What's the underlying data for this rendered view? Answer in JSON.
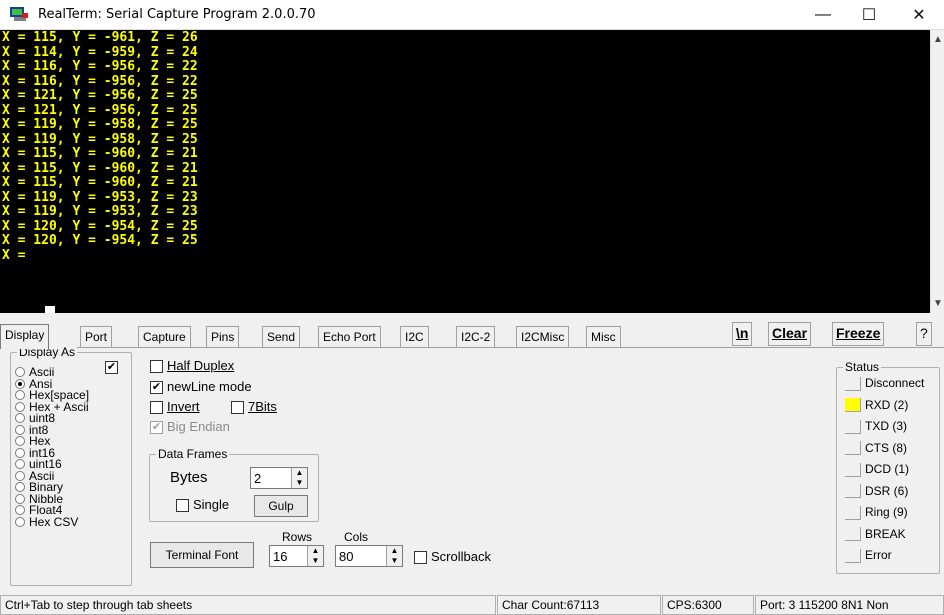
{
  "window": {
    "title": "RealTerm: Serial Capture Program 2.0.0.70",
    "minimize": "—",
    "maximize": "☐",
    "close": "✕"
  },
  "terminal": {
    "lines": [
      "X = 115, Y = -961, Z = 26",
      "X = 114, Y = -959, Z = 24",
      "X = 116, Y = -956, Z = 22",
      "X = 116, Y = -956, Z = 22",
      "X = 121, Y = -956, Z = 25",
      "X = 121, Y = -956, Z = 25",
      "X = 119, Y = -958, Z = 25",
      "X = 119, Y = -958, Z = 25",
      "X = 115, Y = -960, Z = 21",
      "X = 115, Y = -960, Z = 21",
      "X = 115, Y = -960, Z = 21",
      "X = 119, Y = -953, Z = 23",
      "X = 119, Y = -953, Z = 23",
      "X = 120, Y = -954, Z = 25",
      "X = 120, Y = -954, Z = 25",
      "X = "
    ],
    "text_color": "#ffff00",
    "background": "#000000"
  },
  "tabs": [
    {
      "label": "Display",
      "active": true
    },
    {
      "label": "Port"
    },
    {
      "label": "Capture"
    },
    {
      "label": "Pins"
    },
    {
      "label": "Send"
    },
    {
      "label": "Echo Port"
    },
    {
      "label": "I2C"
    },
    {
      "label": "I2C-2"
    },
    {
      "label": "I2CMisc"
    },
    {
      "label": "Misc"
    }
  ],
  "toolbar": {
    "newline_label": "\\n",
    "clear_label": "Clear",
    "freeze_label": "Freeze",
    "help_label": "?"
  },
  "display_as": {
    "legend": "Display As",
    "options": [
      {
        "label": "Ascii",
        "selected": false
      },
      {
        "label": "Ansi",
        "selected": true
      },
      {
        "label": "Hex[space]",
        "selected": false
      },
      {
        "label": "Hex + Ascii",
        "selected": false
      },
      {
        "label": "uint8",
        "selected": false
      },
      {
        "label": "int8",
        "selected": false
      },
      {
        "label": "Hex",
        "selected": false
      },
      {
        "label": "int16",
        "selected": false
      },
      {
        "label": "uint16",
        "selected": false
      },
      {
        "label": "Ascii",
        "selected": false
      },
      {
        "label": "Binary",
        "selected": false
      },
      {
        "label": "Nibble",
        "selected": false
      },
      {
        "label": "Float4",
        "selected": false
      },
      {
        "label": "Hex CSV",
        "selected": false
      }
    ],
    "ascii_checkbox_checked": true
  },
  "options": {
    "half_duplex": {
      "label": "Half Duplex",
      "checked": false
    },
    "newline_mode": {
      "label": "newLine mode",
      "checked": true
    },
    "invert": {
      "label": "Invert",
      "checked": false
    },
    "seven_bits": {
      "label": "7Bits",
      "checked": false
    },
    "big_endian": {
      "label": "Big Endian",
      "checked": true,
      "disabled": true
    }
  },
  "data_frames": {
    "legend": "Data Frames",
    "bytes_label": "Bytes",
    "bytes_value": "2",
    "single_label": "Single",
    "single_checked": false,
    "gulp_label": "Gulp"
  },
  "terminal_settings": {
    "font_button": "Terminal Font",
    "rows_label": "Rows",
    "rows_value": "16",
    "cols_label": "Cols",
    "cols_value": "80",
    "scrollback_label": "Scrollback",
    "scrollback_checked": false
  },
  "status": {
    "legend": "Status",
    "items": [
      {
        "label": "Disconnect",
        "active": false
      },
      {
        "label": "RXD (2)",
        "active": true
      },
      {
        "label": "TXD (3)",
        "active": false
      },
      {
        "label": "CTS (8)",
        "active": false
      },
      {
        "label": "DCD (1)",
        "active": false
      },
      {
        "label": "DSR (6)",
        "active": false
      },
      {
        "label": "Ring (9)",
        "active": false
      },
      {
        "label": "BREAK",
        "active": false
      },
      {
        "label": "Error",
        "active": false
      }
    ],
    "active_color": "#ffff00"
  },
  "statusbar": {
    "hint": "Ctrl+Tab to step through tab sheets",
    "char_count": "Char Count:67113",
    "cps": "CPS:6300",
    "port": "Port: 3 115200 8N1 Non"
  }
}
